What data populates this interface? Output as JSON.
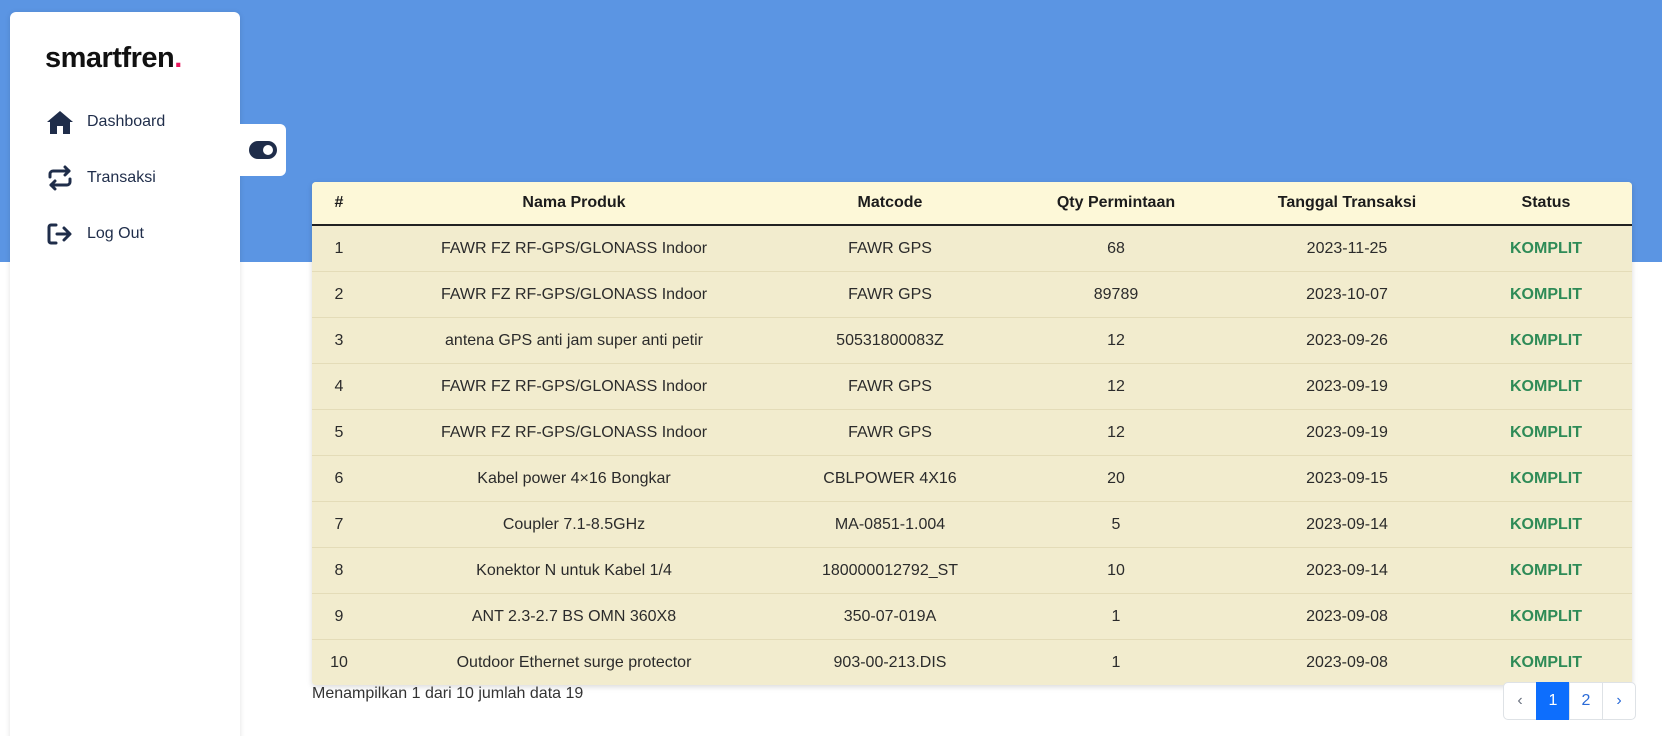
{
  "brand": {
    "name": "smartfren",
    "dot": "."
  },
  "sidebar": {
    "items": [
      {
        "label": "Dashboard",
        "icon": "home-icon"
      },
      {
        "label": "Transaksi",
        "icon": "swap-icon"
      },
      {
        "label": "Log Out",
        "icon": "logout-icon"
      }
    ]
  },
  "toggle": {
    "icon": "toggle-icon"
  },
  "table": {
    "headers": [
      "#",
      "Nama Produk",
      "Matcode",
      "Qty Permintaan",
      "Tanggal Transaksi",
      "Status"
    ],
    "rows": [
      [
        "1",
        "FAWR FZ RF-GPS/GLONASS Indoor",
        "FAWR GPS",
        "68",
        "2023-11-25",
        "KOMPLIT"
      ],
      [
        "2",
        "FAWR FZ RF-GPS/GLONASS Indoor",
        "FAWR GPS",
        "89789",
        "2023-10-07",
        "KOMPLIT"
      ],
      [
        "3",
        "antena GPS anti jam super anti petir",
        "50531800083Z",
        "12",
        "2023-09-26",
        "KOMPLIT"
      ],
      [
        "4",
        "FAWR FZ RF-GPS/GLONASS Indoor",
        "FAWR GPS",
        "12",
        "2023-09-19",
        "KOMPLIT"
      ],
      [
        "5",
        "FAWR FZ RF-GPS/GLONASS Indoor",
        "FAWR GPS",
        "12",
        "2023-09-19",
        "KOMPLIT"
      ],
      [
        "6",
        "Kabel power 4×16 Bongkar",
        "CBLPOWER 4X16",
        "20",
        "2023-09-15",
        "KOMPLIT"
      ],
      [
        "7",
        "Coupler 7.1-8.5GHz",
        "MA-0851-1.004",
        "5",
        "2023-09-14",
        "KOMPLIT"
      ],
      [
        "8",
        "Konektor N untuk Kabel 1/4",
        "180000012792_ST",
        "10",
        "2023-09-14",
        "KOMPLIT"
      ],
      [
        "9",
        "ANT 2.3-2.7 BS OMN 360X8",
        "350-07-019A",
        "1",
        "2023-09-08",
        "KOMPLIT"
      ],
      [
        "10",
        "Outdoor Ethernet surge protector",
        "903-00-213.DIS",
        "1",
        "2023-09-08",
        "KOMPLIT"
      ]
    ]
  },
  "footer": {
    "summary": "Menampilkan 1 dari 10 jumlah data 19"
  },
  "pagination": {
    "prev": "‹",
    "pages": [
      "1",
      "2"
    ],
    "next": "›",
    "active": "1"
  },
  "colors": {
    "banner": "#5b95e3",
    "status": "#2e8b57",
    "table_bg": "#f2ecce",
    "header_bg": "#fdf8d8",
    "active_page": "#0d6efd",
    "brand_dot": "#e8175d"
  }
}
